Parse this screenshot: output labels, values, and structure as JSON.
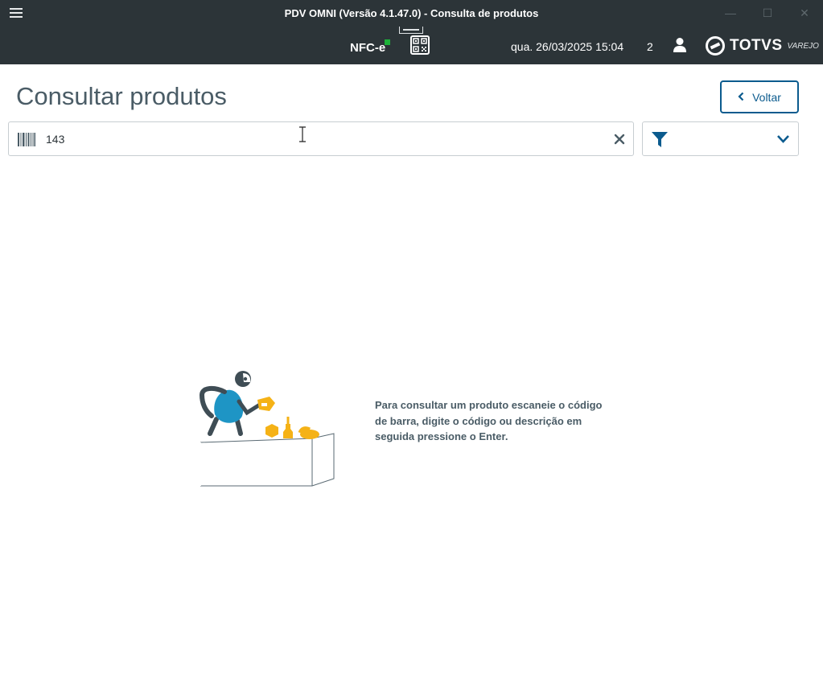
{
  "window": {
    "title": "PDV OMNI (Versão 4.1.47.0) - Consulta de produtos",
    "minimize": "—",
    "maximize": "☐",
    "close": "✕"
  },
  "statusbar": {
    "fiscal_mode": "NFC-e",
    "datetime": "qua. 26/03/2025 15:04",
    "count": "2",
    "logo_text": "TOTVS",
    "logo_subtext": "VAREJO",
    "fiscal_status_color": "#1db33a"
  },
  "page": {
    "title": "Consultar produtos",
    "back_label": "Voltar"
  },
  "search": {
    "value": "143"
  },
  "empty_state": {
    "message": "Para consultar um produto escaneie o código de barra, digite o código ou descrição em seguida pressione o Enter."
  },
  "colors": {
    "header_bg": "#2c3438",
    "accent": "#0b5b8e",
    "text": "#4a5c66",
    "figure_blue": "#1e95c5",
    "product_yellow": "#f5b216"
  },
  "icons": [
    "menu-icon",
    "printer-icon",
    "qr-code-icon",
    "user-icon",
    "totvs-logo",
    "chevron-left-icon",
    "barcode-icon",
    "clear-icon",
    "filter-icon",
    "chevron-down-icon"
  ]
}
